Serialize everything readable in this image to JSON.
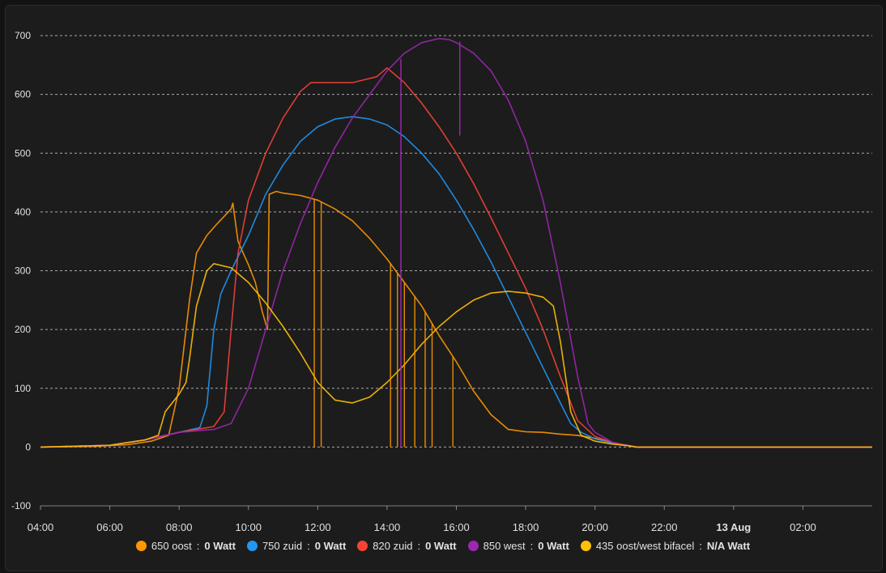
{
  "chart_data": {
    "type": "line",
    "ylim": [
      -100,
      700
    ],
    "yticks": [
      -100,
      0,
      100,
      200,
      300,
      400,
      500,
      600,
      700
    ],
    "x_ticks": [
      "04:00",
      "06:00",
      "08:00",
      "10:00",
      "12:00",
      "14:00",
      "16:00",
      "18:00",
      "20:00",
      "22:00",
      "13 Aug",
      "02:00"
    ],
    "x_ticks_bold": [
      "13 Aug"
    ],
    "xlim_hours": [
      4,
      28
    ],
    "grid": "horizontal-dashed",
    "legend_position": "bottom",
    "series": [
      {
        "name": "650 oost",
        "value": "0",
        "unit": "Watt",
        "color": "#ff9800",
        "x": [
          4,
          5.5,
          6.5,
          7.2,
          7.7,
          8,
          8.3,
          8.5,
          8.8,
          9.1,
          9.5,
          9.55,
          9.7,
          9.85,
          10,
          10.2,
          10.4,
          10.55,
          10.6,
          10.8,
          11,
          11.5,
          12,
          12.5,
          13,
          13.5,
          14,
          14.5,
          15,
          15.5,
          16,
          16.5,
          17,
          17.5,
          18,
          18.5,
          19,
          19.5,
          20,
          20.5,
          21,
          21.2,
          22,
          24,
          26,
          28
        ],
        "y": [
          0,
          1,
          4,
          10,
          20,
          100,
          250,
          330,
          360,
          380,
          405,
          415,
          350,
          330,
          310,
          280,
          230,
          200,
          430,
          435,
          432,
          428,
          420,
          405,
          385,
          355,
          320,
          280,
          240,
          190,
          145,
          95,
          55,
          30,
          26,
          25,
          22,
          20,
          15,
          8,
          2,
          0,
          0,
          0,
          0,
          0
        ]
      },
      {
        "name": "750 zuid",
        "value": "0",
        "unit": "Watt",
        "color": "#2196f3",
        "x": [
          4,
          6,
          7,
          8,
          8.6,
          8.8,
          9,
          9.2,
          9.5,
          10,
          10.5,
          11,
          11.5,
          12,
          12.5,
          13,
          13.5,
          14,
          14.5,
          15,
          15.5,
          16,
          16.5,
          17,
          17.5,
          18,
          18.5,
          19,
          19.3,
          19.6,
          20,
          20.5,
          21,
          21.2,
          22,
          24,
          26,
          28
        ],
        "y": [
          0,
          3,
          12,
          25,
          33,
          70,
          200,
          260,
          300,
          360,
          430,
          480,
          520,
          545,
          558,
          562,
          558,
          548,
          528,
          500,
          465,
          420,
          370,
          315,
          255,
          195,
          135,
          75,
          40,
          25,
          14,
          7,
          2,
          0,
          0,
          0,
          0,
          0
        ]
      },
      {
        "name": "820 zuid",
        "value": "0",
        "unit": "Watt",
        "color": "#f44336",
        "x": [
          4,
          6,
          7,
          8,
          9,
          9.3,
          9.5,
          9.7,
          10,
          10.5,
          11,
          11.5,
          11.8,
          12,
          13,
          13.7,
          14,
          14.5,
          15,
          15.5,
          16,
          16.5,
          17,
          17.5,
          18,
          18.5,
          19,
          19.5,
          20,
          20.5,
          21,
          21.2,
          22,
          24,
          26,
          28
        ],
        "y": [
          0,
          3,
          12,
          25,
          35,
          60,
          200,
          330,
          420,
          500,
          560,
          605,
          620,
          620,
          620,
          630,
          645,
          620,
          585,
          545,
          500,
          448,
          390,
          330,
          270,
          200,
          120,
          45,
          18,
          8,
          2,
          0,
          0,
          0,
          0,
          0
        ]
      },
      {
        "name": "850 west",
        "value": "0",
        "unit": "Watt",
        "color": "#9c27b0",
        "x": [
          4,
          6,
          7,
          8,
          9,
          9.5,
          10,
          10.5,
          11,
          11.5,
          12,
          12.5,
          13,
          13.5,
          14,
          14.5,
          15,
          15.5,
          15.8,
          16,
          16.5,
          17,
          17.5,
          18,
          18.5,
          19,
          19.5,
          19.8,
          20,
          20.3,
          20.5,
          21,
          21.2,
          22,
          24,
          26,
          28
        ],
        "y": [
          0,
          3,
          12,
          25,
          30,
          40,
          100,
          200,
          300,
          380,
          450,
          510,
          560,
          600,
          640,
          670,
          688,
          695,
          693,
          688,
          670,
          640,
          590,
          520,
          420,
          280,
          120,
          40,
          25,
          15,
          8,
          2,
          0,
          0,
          0,
          0,
          0
        ]
      },
      {
        "name": "435 oost/west bifacel",
        "value": "N/A",
        "unit": "Watt",
        "color": "#ffc107",
        "x": [
          4,
          6,
          7,
          7.4,
          7.6,
          8,
          8.2,
          8.3,
          8.5,
          8.8,
          9,
          9.5,
          10,
          10.5,
          11,
          11.5,
          12,
          12.5,
          13,
          13.5,
          14,
          14.5,
          15,
          15.5,
          16,
          16.5,
          17,
          17.5,
          18,
          18.5,
          18.8,
          19,
          19.3,
          19.6,
          20,
          20.5,
          21,
          21.2,
          22,
          24,
          26,
          28
        ],
        "y": [
          0,
          3,
          12,
          20,
          60,
          90,
          110,
          150,
          240,
          300,
          312,
          305,
          280,
          245,
          205,
          160,
          110,
          80,
          75,
          85,
          110,
          140,
          175,
          205,
          230,
          250,
          262,
          265,
          262,
          255,
          240,
          180,
          60,
          20,
          10,
          5,
          2,
          0,
          0,
          0,
          0,
          0
        ]
      }
    ]
  }
}
